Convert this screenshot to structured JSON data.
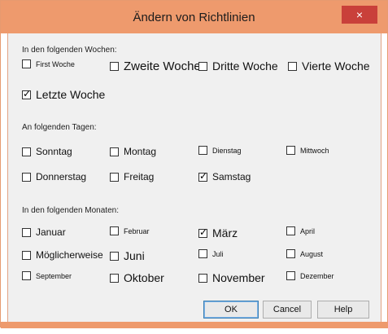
{
  "dialog": {
    "title": "Ändern von Richtlinien",
    "close_label": "×"
  },
  "weeks": {
    "label": "In den folgenden Wochen:",
    "options": [
      {
        "label": "First Woche",
        "checked": false
      },
      {
        "label": "Zweite Woche",
        "checked": false
      },
      {
        "label": "Dritte Woche",
        "checked": false
      },
      {
        "label": "Vierte Woche",
        "checked": false
      },
      {
        "label": "Letzte Woche",
        "checked": true
      }
    ]
  },
  "days": {
    "label": "An folgenden Tagen:",
    "options": [
      {
        "label": "Sonntag",
        "checked": false
      },
      {
        "label": "Montag",
        "checked": false
      },
      {
        "label": "Dienstag",
        "checked": false
      },
      {
        "label": "Mittwoch",
        "checked": false
      },
      {
        "label": "Donnerstag",
        "checked": false
      },
      {
        "label": "Freitag",
        "checked": false
      },
      {
        "label": "Samstag",
        "checked": true
      }
    ]
  },
  "months": {
    "label": "In den folgenden Monaten:",
    "options": [
      {
        "label": "Januar",
        "checked": false
      },
      {
        "label": "Februar",
        "checked": false
      },
      {
        "label": "März",
        "checked": true
      },
      {
        "label": "April",
        "checked": false
      },
      {
        "label": "Möglicherweise",
        "checked": false
      },
      {
        "label": "Juni",
        "checked": false
      },
      {
        "label": "Juli",
        "checked": false
      },
      {
        "label": "August",
        "checked": false
      },
      {
        "label": "September",
        "checked": false
      },
      {
        "label": "Oktober",
        "checked": false
      },
      {
        "label": "November",
        "checked": false
      },
      {
        "label": "Dezember",
        "checked": false
      }
    ]
  },
  "buttons": {
    "ok": "OK",
    "cancel": "Cancel",
    "help": "Help"
  },
  "colors": {
    "titlebar": "#ee9a6d",
    "close": "#c9403a",
    "body": "#f0f0f0"
  }
}
